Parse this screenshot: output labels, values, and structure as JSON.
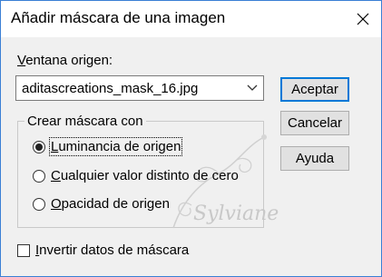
{
  "window": {
    "title": "Añadir máscara de una imagen"
  },
  "source": {
    "label_first": "V",
    "label_rest": "entana origen:",
    "selected_file": "aditascreations_mask_16.jpg"
  },
  "buttons": {
    "accept": "Aceptar",
    "cancel": "Cancelar",
    "help": "Ayuda"
  },
  "mask_group": {
    "legend": "Crear máscara con",
    "options": [
      {
        "first": "L",
        "rest": "uminancia de origen",
        "checked": true
      },
      {
        "first": "C",
        "rest": "ualquier valor distinto de cero",
        "checked": false
      },
      {
        "first": "O",
        "rest": "pacidad de origen",
        "checked": false
      }
    ]
  },
  "invert": {
    "first": "I",
    "rest": "nvertir datos de máscara",
    "checked": false
  },
  "watermark": {
    "text": "Sylviane"
  }
}
